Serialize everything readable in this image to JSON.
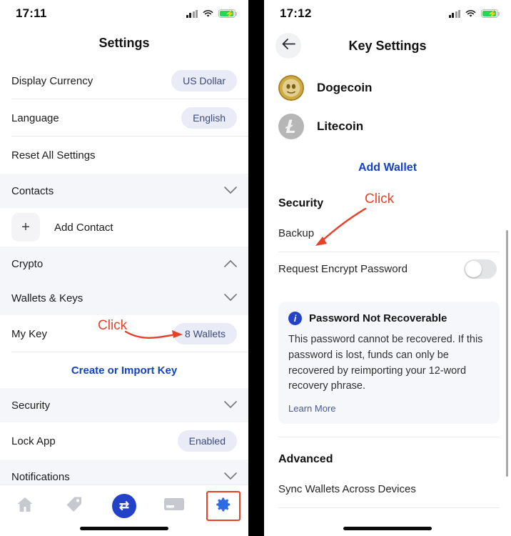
{
  "left_screen": {
    "status_bar": {
      "time": "17:11",
      "signal_icon": "cellular-signal-icon",
      "wifi_icon": "wifi-icon",
      "battery_icon": "battery-charging-icon"
    },
    "title": "Settings",
    "rows": [
      {
        "type": "row",
        "label": "Display Currency",
        "value": "US Dollar"
      },
      {
        "type": "row",
        "label": "Language",
        "value": "English"
      },
      {
        "type": "row",
        "label": "Reset All Settings",
        "value": ""
      },
      {
        "type": "section",
        "label": "Contacts",
        "chevron": "chevron-down-icon"
      },
      {
        "type": "add",
        "label": "Add Contact",
        "icon": "plus-icon"
      },
      {
        "type": "section",
        "label": "Crypto",
        "chevron": "chevron-up-icon"
      },
      {
        "type": "section",
        "label": "Wallets & Keys",
        "chevron": "chevron-down-icon"
      },
      {
        "type": "row",
        "label": "My Key",
        "value": "8 Wallets"
      },
      {
        "type": "link",
        "label": "Create or Import Key"
      },
      {
        "type": "section",
        "label": "Security",
        "chevron": "chevron-down-icon"
      },
      {
        "type": "row",
        "label": "Lock App",
        "value": "Enabled"
      },
      {
        "type": "section",
        "label": "Notifications",
        "chevron": "chevron-down-icon"
      }
    ],
    "annotation": {
      "text": "Click",
      "color": "#e8412a",
      "points_to": "8 Wallets"
    },
    "tabbar": {
      "items": [
        {
          "name": "home-icon",
          "selected": false
        },
        {
          "name": "tag-icon",
          "selected": false
        },
        {
          "name": "swap-icon",
          "label": "⇄",
          "selected": false
        },
        {
          "name": "card-icon",
          "selected": false
        },
        {
          "name": "gear-icon",
          "selected": true
        }
      ]
    }
  },
  "right_screen": {
    "status_bar": {
      "time": "17:12",
      "signal_icon": "cellular-signal-icon",
      "wifi_icon": "wifi-icon",
      "battery_icon": "battery-charging-icon"
    },
    "back_icon": "back-arrow-icon",
    "title": "Key Settings",
    "wallets": [
      {
        "name": "Dogecoin",
        "icon": "dogecoin-icon",
        "color": "#c9a227",
        "symbol": "Ð"
      },
      {
        "name": "Litecoin",
        "icon": "litecoin-icon",
        "color": "#b4b4b4",
        "symbol": "Ł"
      }
    ],
    "add_wallet_label": "Add Wallet",
    "security": {
      "title": "Security",
      "backup_label": "Backup",
      "request_encrypt_label": "Request Encrypt Password",
      "toggle_state": "off",
      "info_card": {
        "icon": "info-icon",
        "title": "Password Not Recoverable",
        "body": "This password cannot be recovered. If this password is lost, funds can only be recovered by reimporting your 12-word recovery phrase.",
        "link": "Learn More"
      }
    },
    "advanced": {
      "title": "Advanced",
      "sync_label": "Sync Wallets Across Devices"
    },
    "annotation": {
      "text": "Click",
      "color": "#e8412a",
      "points_to": "Backup"
    }
  },
  "colors": {
    "accent_blue": "#1341c4",
    "pill_bg": "#e9ecf7",
    "pill_text": "#3b4a7a",
    "annotation_red": "#e8412a",
    "section_bg": "#f4f6fa",
    "tab_active": "#2d6ae3"
  }
}
